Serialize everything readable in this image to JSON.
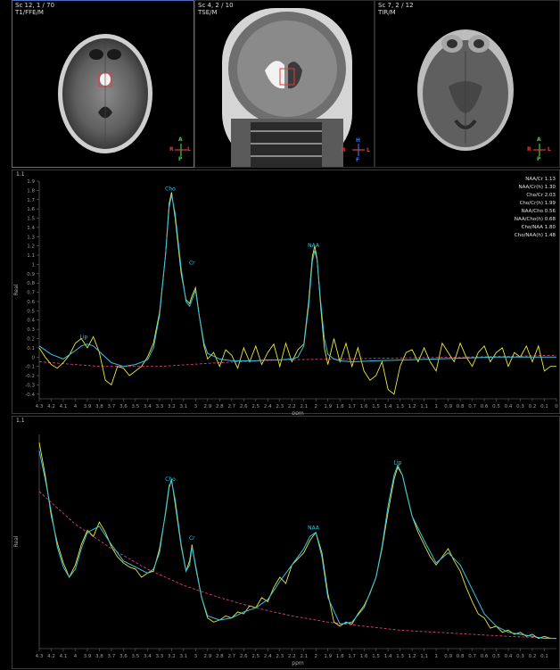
{
  "viewports": [
    {
      "id": "vp1",
      "series": "Sc 12, 1 / 70",
      "sequence": "T1/FFE/M",
      "orientation": {
        "top": "A",
        "bottom": "P",
        "left": "R",
        "right": "L"
      }
    },
    {
      "id": "vp2",
      "series": "Sc 4, 2 / 10",
      "sequence": "TSE/M",
      "orientation": {
        "top": "H",
        "bottom": "F",
        "left": "R",
        "right": "L"
      }
    },
    {
      "id": "vp3",
      "series": "Sc 7, 2 / 12",
      "sequence": "TIR/M",
      "orientation": {
        "top": "A",
        "bottom": "P",
        "left": "R",
        "right": "L"
      }
    }
  ],
  "colors": {
    "fit": "#35c6e6",
    "raw": "#e9e83a",
    "baseline": "#d8407a",
    "selected_border": "#4a6fc0",
    "orient_green": "#39d639",
    "orient_red": "#e23a3a",
    "orient_blue": "#3a6fe2"
  },
  "spectrum1": {
    "corner": "1.1",
    "ratios": [
      {
        "label": "NAA/Cr",
        "value": "1.13"
      },
      {
        "label": "NAA/Cr(h)",
        "value": "1.30"
      },
      {
        "label": "Cho/Cr",
        "value": "2.03"
      },
      {
        "label": "Cho/Cr(h)",
        "value": "1.99"
      },
      {
        "label": "NAA/Cho",
        "value": "0.56"
      },
      {
        "label": "NAA/Cho(h)",
        "value": "0.68"
      },
      {
        "label": "Cho/NAA",
        "value": "1.80"
      },
      {
        "label": "Cho/NAA(h)",
        "value": "1.48"
      }
    ]
  },
  "spectrum2": {
    "corner": "1.1"
  },
  "chart_data": [
    {
      "type": "line",
      "xlabel": "ppm",
      "ylabel": "Real",
      "xlim": [
        4.3,
        0.0
      ],
      "ylim": [
        -0.45,
        1.9
      ],
      "x_ticks": [
        "4.3",
        "4.2",
        "4.1",
        "4",
        "3.9",
        "3.8",
        "3.7",
        "3.6",
        "3.5",
        "3.4",
        "3.3",
        "3.2",
        "3.1",
        "3",
        "2.9",
        "2.8",
        "2.7",
        "2.6",
        "2.5",
        "2.4",
        "2.3",
        "2.2",
        "2.1",
        "2",
        "1.9",
        "1.8",
        "1.7",
        "1.6",
        "1.5",
        "1.4",
        "1.3",
        "1.2",
        "1.1",
        "1",
        "0.9",
        "0.8",
        "0.7",
        "0.6",
        "0.5",
        "0.4",
        "0.3",
        "0.2",
        "0.1",
        "0"
      ],
      "y_ticks": [
        "1.9",
        "1.8",
        "1.7",
        "1.6",
        "1.5",
        "1.4",
        "1.3",
        "1.2",
        "1.1",
        "1",
        "0.9",
        "0.8",
        "0.7",
        "0.6",
        "0.5",
        "0.4",
        "0.3",
        "0.2",
        "0.1",
        "0",
        "-0.1",
        "-0.2",
        "-0.3",
        "-0.4"
      ],
      "peak_labels": [
        {
          "text": "Cho",
          "x": 3.21,
          "y": 1.77
        },
        {
          "text": "Cr",
          "x": 3.03,
          "y": 0.97
        },
        {
          "text": "Lip",
          "x": 3.93,
          "y": 0.17
        },
        {
          "text": "NAA",
          "x": 2.02,
          "y": 1.16
        }
      ],
      "series": [
        {
          "role": "fit",
          "x": [
            4.3,
            4.2,
            4.1,
            4.0,
            3.95,
            3.9,
            3.85,
            3.8,
            3.7,
            3.6,
            3.5,
            3.4,
            3.35,
            3.3,
            3.25,
            3.22,
            3.2,
            3.17,
            3.12,
            3.08,
            3.05,
            3.03,
            3.0,
            2.97,
            2.93,
            2.9,
            2.8,
            2.7,
            2.6,
            2.5,
            2.4,
            2.3,
            2.2,
            2.15,
            2.1,
            2.06,
            2.03,
            2.01,
            1.99,
            1.96,
            1.93,
            1.9,
            1.85,
            1.8,
            1.7,
            1.5,
            1.0,
            0.5,
            0.0
          ],
          "y": [
            0.12,
            0.03,
            -0.02,
            0.07,
            0.12,
            0.14,
            0.12,
            0.06,
            -0.06,
            -0.1,
            -0.08,
            -0.03,
            0.1,
            0.45,
            1.1,
            1.62,
            1.75,
            1.55,
            0.95,
            0.6,
            0.55,
            0.62,
            0.72,
            0.45,
            0.15,
            0.04,
            -0.02,
            -0.04,
            -0.04,
            -0.04,
            -0.03,
            -0.03,
            -0.02,
            0.0,
            0.12,
            0.55,
            1.03,
            1.15,
            1.05,
            0.6,
            0.2,
            0.03,
            -0.02,
            -0.04,
            -0.05,
            -0.04,
            -0.02,
            0.0,
            0.0
          ]
        },
        {
          "role": "raw",
          "x": [
            4.3,
            4.25,
            4.2,
            4.15,
            4.1,
            4.05,
            4.0,
            3.95,
            3.9,
            3.85,
            3.8,
            3.75,
            3.7,
            3.65,
            3.6,
            3.55,
            3.5,
            3.45,
            3.4,
            3.35,
            3.3,
            3.25,
            3.22,
            3.2,
            3.17,
            3.12,
            3.08,
            3.05,
            3.03,
            3.0,
            2.97,
            2.93,
            2.9,
            2.85,
            2.8,
            2.75,
            2.7,
            2.65,
            2.6,
            2.55,
            2.5,
            2.45,
            2.4,
            2.35,
            2.3,
            2.25,
            2.2,
            2.15,
            2.1,
            2.06,
            2.03,
            2.01,
            1.99,
            1.96,
            1.93,
            1.9,
            1.85,
            1.8,
            1.75,
            1.7,
            1.65,
            1.6,
            1.55,
            1.5,
            1.45,
            1.4,
            1.35,
            1.3,
            1.25,
            1.2,
            1.15,
            1.1,
            1.05,
            1.0,
            0.95,
            0.9,
            0.85,
            0.8,
            0.75,
            0.7,
            0.65,
            0.6,
            0.55,
            0.5,
            0.45,
            0.4,
            0.35,
            0.3,
            0.25,
            0.2,
            0.15,
            0.1,
            0.05,
            0.0
          ],
          "y": [
            0.1,
            0.0,
            -0.08,
            -0.12,
            -0.06,
            0.02,
            0.15,
            0.2,
            0.1,
            0.22,
            0.05,
            -0.25,
            -0.3,
            -0.1,
            -0.12,
            -0.2,
            -0.15,
            -0.1,
            0.0,
            0.15,
            0.48,
            1.1,
            1.66,
            1.78,
            1.5,
            0.9,
            0.62,
            0.58,
            0.66,
            0.75,
            0.45,
            0.12,
            -0.02,
            0.05,
            -0.1,
            0.08,
            0.02,
            -0.12,
            0.1,
            -0.05,
            0.12,
            -0.08,
            0.05,
            0.14,
            -0.1,
            0.15,
            -0.05,
            0.08,
            0.14,
            0.6,
            1.08,
            1.2,
            1.06,
            0.55,
            0.1,
            -0.08,
            0.2,
            -0.05,
            0.15,
            -0.1,
            0.1,
            -0.15,
            -0.25,
            -0.2,
            -0.05,
            -0.35,
            -0.4,
            -0.1,
            0.05,
            0.08,
            -0.05,
            0.1,
            -0.05,
            -0.15,
            0.15,
            0.05,
            -0.05,
            0.15,
            0.0,
            -0.1,
            0.05,
            0.12,
            -0.05,
            0.05,
            0.1,
            -0.1,
            0.05,
            0.0,
            0.12,
            -0.05,
            0.12,
            -0.15,
            -0.1,
            -0.1
          ]
        },
        {
          "role": "baseline",
          "x": [
            4.3,
            3.8,
            3.3,
            2.8,
            2.3,
            1.8,
            1.3,
            0.8,
            0.3,
            0.0
          ],
          "y": [
            -0.05,
            -0.1,
            -0.1,
            -0.06,
            -0.03,
            -0.02,
            -0.01,
            0.0,
            0.01,
            0.02
          ]
        }
      ]
    },
    {
      "type": "line",
      "xlabel": "ppm",
      "ylabel": "Real",
      "xlim": [
        4.3,
        0.0
      ],
      "ylim": [
        -0.05,
        1.0
      ],
      "x_ticks": [
        "4.3",
        "4.2",
        "4.1",
        "4",
        "3.9",
        "3.8",
        "3.7",
        "3.6",
        "3.5",
        "3.4",
        "3.3",
        "3.2",
        "3.1",
        "3",
        "2.9",
        "2.8",
        "2.7",
        "2.6",
        "2.5",
        "2.4",
        "2.3",
        "2.2",
        "2.1",
        "2",
        "1.9",
        "1.8",
        "1.7",
        "1.6",
        "1.5",
        "1.4",
        "1.3",
        "1.2",
        "1.1",
        "1",
        "0.9",
        "0.8",
        "0.7",
        "0.6",
        "0.5",
        "0.4",
        "0.3",
        "0.2",
        "0.1"
      ],
      "peak_labels": [
        {
          "text": "Cho",
          "x": 3.21,
          "y": 0.76
        },
        {
          "text": "Cr",
          "x": 3.03,
          "y": 0.47
        },
        {
          "text": "Lip",
          "x": 1.32,
          "y": 0.84
        },
        {
          "text": "NAA",
          "x": 2.02,
          "y": 0.52
        }
      ],
      "series": [
        {
          "role": "fit",
          "x": [
            4.3,
            4.25,
            4.2,
            4.15,
            4.1,
            4.05,
            4.0,
            3.95,
            3.9,
            3.8,
            3.7,
            3.6,
            3.5,
            3.4,
            3.35,
            3.3,
            3.25,
            3.22,
            3.2,
            3.17,
            3.12,
            3.08,
            3.05,
            3.03,
            3.0,
            2.95,
            2.9,
            2.8,
            2.7,
            2.6,
            2.5,
            2.4,
            2.3,
            2.2,
            2.1,
            2.05,
            2.0,
            1.95,
            1.9,
            1.8,
            1.7,
            1.6,
            1.5,
            1.45,
            1.4,
            1.35,
            1.32,
            1.28,
            1.2,
            1.1,
            1.0,
            0.9,
            0.8,
            0.7,
            0.6,
            0.5,
            0.4,
            0.3,
            0.2,
            0.1,
            0.0
          ],
          "y": [
            0.92,
            0.78,
            0.62,
            0.45,
            0.35,
            0.3,
            0.34,
            0.44,
            0.52,
            0.55,
            0.46,
            0.38,
            0.35,
            0.32,
            0.34,
            0.42,
            0.62,
            0.75,
            0.77,
            0.68,
            0.46,
            0.33,
            0.36,
            0.45,
            0.36,
            0.2,
            0.11,
            0.09,
            0.1,
            0.13,
            0.15,
            0.19,
            0.28,
            0.36,
            0.44,
            0.5,
            0.52,
            0.4,
            0.2,
            0.07,
            0.08,
            0.15,
            0.3,
            0.45,
            0.65,
            0.8,
            0.85,
            0.8,
            0.6,
            0.48,
            0.37,
            0.42,
            0.36,
            0.24,
            0.12,
            0.06,
            0.03,
            0.02,
            0.01,
            0.0,
            0.0
          ]
        },
        {
          "role": "raw",
          "x": [
            4.3,
            4.25,
            4.2,
            4.15,
            4.1,
            4.05,
            4.0,
            3.95,
            3.9,
            3.85,
            3.8,
            3.75,
            3.7,
            3.65,
            3.6,
            3.55,
            3.5,
            3.45,
            3.4,
            3.35,
            3.3,
            3.25,
            3.22,
            3.2,
            3.17,
            3.12,
            3.08,
            3.05,
            3.03,
            3.0,
            2.95,
            2.9,
            2.85,
            2.8,
            2.75,
            2.7,
            2.65,
            2.6,
            2.55,
            2.5,
            2.45,
            2.4,
            2.35,
            2.3,
            2.25,
            2.2,
            2.15,
            2.1,
            2.05,
            2.0,
            1.95,
            1.9,
            1.85,
            1.8,
            1.75,
            1.7,
            1.65,
            1.6,
            1.55,
            1.5,
            1.45,
            1.4,
            1.35,
            1.32,
            1.28,
            1.25,
            1.2,
            1.15,
            1.1,
            1.05,
            1.0,
            0.95,
            0.9,
            0.85,
            0.8,
            0.75,
            0.7,
            0.65,
            0.6,
            0.55,
            0.5,
            0.45,
            0.4,
            0.35,
            0.3,
            0.25,
            0.2,
            0.15,
            0.1,
            0.05,
            0.0
          ],
          "y": [
            0.96,
            0.8,
            0.6,
            0.47,
            0.37,
            0.3,
            0.36,
            0.46,
            0.53,
            0.5,
            0.57,
            0.52,
            0.45,
            0.4,
            0.37,
            0.35,
            0.34,
            0.3,
            0.32,
            0.33,
            0.44,
            0.61,
            0.74,
            0.78,
            0.66,
            0.45,
            0.33,
            0.38,
            0.46,
            0.35,
            0.2,
            0.1,
            0.08,
            0.09,
            0.11,
            0.1,
            0.13,
            0.12,
            0.16,
            0.15,
            0.2,
            0.18,
            0.25,
            0.3,
            0.27,
            0.36,
            0.39,
            0.42,
            0.48,
            0.52,
            0.42,
            0.22,
            0.08,
            0.06,
            0.08,
            0.07,
            0.12,
            0.16,
            0.22,
            0.3,
            0.44,
            0.62,
            0.78,
            0.84,
            0.8,
            0.72,
            0.6,
            0.52,
            0.46,
            0.4,
            0.36,
            0.4,
            0.44,
            0.38,
            0.33,
            0.25,
            0.18,
            0.12,
            0.1,
            0.05,
            0.06,
            0.03,
            0.04,
            0.02,
            0.03,
            0.01,
            0.02,
            0.0,
            0.01,
            0.0,
            0.0
          ]
        },
        {
          "role": "baseline",
          "x": [
            4.3,
            4.0,
            3.7,
            3.4,
            3.1,
            2.8,
            2.5,
            2.2,
            1.9,
            1.6,
            1.3,
            1.0,
            0.7,
            0.4,
            0.0
          ],
          "y": [
            0.72,
            0.56,
            0.44,
            0.34,
            0.26,
            0.2,
            0.15,
            0.11,
            0.08,
            0.06,
            0.04,
            0.03,
            0.02,
            0.01,
            0.0
          ]
        }
      ]
    }
  ]
}
